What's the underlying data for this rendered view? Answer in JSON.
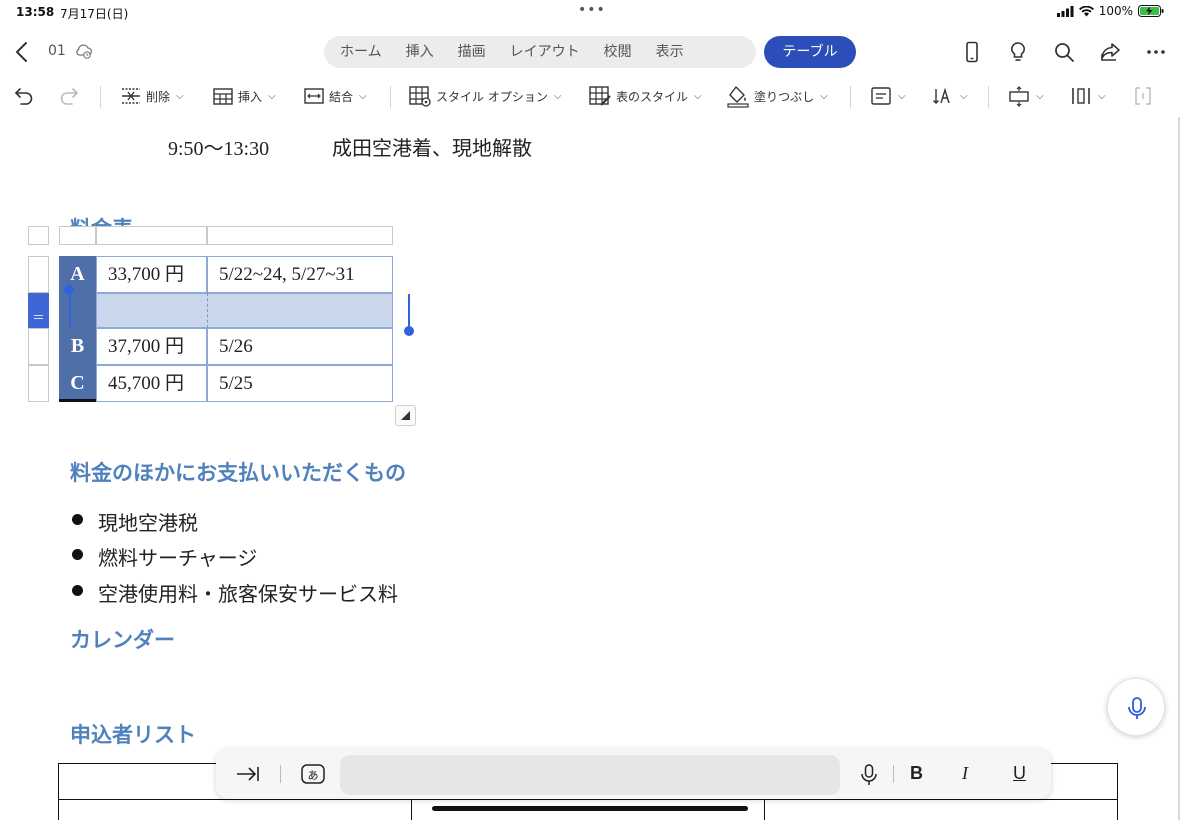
{
  "status": {
    "time": "13:58",
    "date": "7月17日(日)",
    "battery": "100%"
  },
  "header": {
    "doc_name": "01",
    "tabs": [
      "ホーム",
      "挿入",
      "描画",
      "レイアウト",
      "校閲",
      "表示"
    ],
    "active_tab": "テーブル"
  },
  "ribbon": {
    "delete": "削除",
    "insert": "挿入",
    "merge": "結合",
    "style_options": "スタイル オプション",
    "table_styles": "表のスタイル",
    "fill": "塗りつぶし"
  },
  "document": {
    "schedule_line": {
      "time": "9:50〜13:30",
      "text": "成田空港着、現地解散"
    },
    "price_heading": "料金表",
    "price_table": [
      {
        "label": "A",
        "price": "33,700 円",
        "dates": "5/22~24, 5/27~31"
      },
      {
        "label": "",
        "price": "",
        "dates": ""
      },
      {
        "label": "B",
        "price": "37,700 円",
        "dates": "5/26"
      },
      {
        "label": "C",
        "price": "45,700 円",
        "dates": "5/25"
      }
    ],
    "extra_heading": "料金のほかにお支払いいただくもの",
    "extra_items": [
      "現地空港税",
      "燃料サーチャージ",
      "空港使用料・旅客保安サービス料"
    ],
    "calendar_heading": "カレンダー",
    "applicants_heading": "申込者リスト"
  },
  "colors": {
    "accent": "#2b4ebb",
    "heading": "#4f81bd",
    "table_header": "#4f6fa8",
    "selection": "#c9d6ec"
  }
}
